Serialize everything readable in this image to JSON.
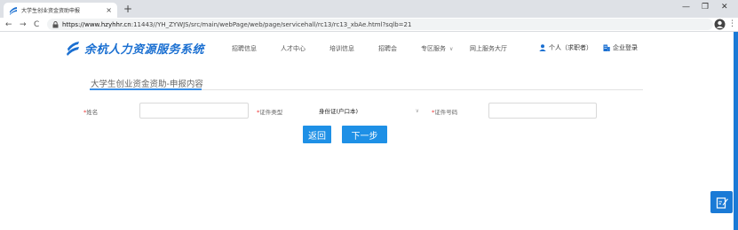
{
  "browser": {
    "tab_title": "大学生创业资金资助申报",
    "tab_close": "×",
    "new_tab": "+",
    "minimize": "—",
    "restore": "❐",
    "close": "✕",
    "back": "←",
    "forward": "→",
    "reload": "C",
    "url_host": "https://www.hzyhhr.cn",
    "url_path": ":11443//YH_ZYWJS/src/main/webPage/web/page/servicehall/rc13/rc13_xbAe.html?sqlb=21",
    "menu": "⋮"
  },
  "header": {
    "logo_text": "余杭人力资源服务系统",
    "nav": [
      {
        "label": "招聘信息"
      },
      {
        "label": "人才中心"
      },
      {
        "label": "培训信息"
      },
      {
        "label": "招聘会"
      },
      {
        "label": "专区服务"
      },
      {
        "label": "网上服务大厅"
      }
    ],
    "nav_chevron": "∨",
    "personal_login": "个人（求职者）",
    "enterprise_login": "企业登录"
  },
  "section": {
    "title": "大学生创业资金资助-申报内容"
  },
  "form": {
    "name_label": "姓名",
    "id_type_label": "证件类型",
    "id_type_value": "身份证(户口本)",
    "id_number_label": "证件号码",
    "required_mark": "*",
    "name_value": "",
    "id_number_value": ""
  },
  "buttons": {
    "back": "返回",
    "next": "下一步"
  },
  "colors": {
    "brand": "#1a6fd1",
    "button": "#1e90e6",
    "required": "#e33333"
  }
}
